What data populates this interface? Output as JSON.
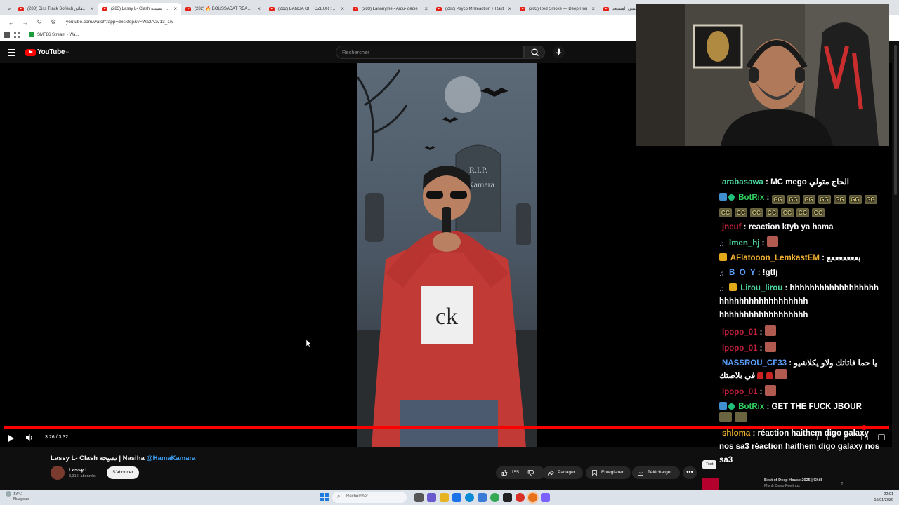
{
  "browser": {
    "tabs": [
      {
        "label": "(283) Diss Track Sofiech حقائق CL"
      },
      {
        "label": "(283) Lassy L- Clash نصيحة | Na"
      },
      {
        "label": "(282) 🔥 BOUSSADAT REACTIC"
      },
      {
        "label": "(282) BANGA OF TOZEUR : Djer"
      },
      {
        "label": "(283) Lanonyme - Ardu- dédie"
      },
      {
        "label": "(282) Psyco M Reaction + Rakt"
      },
      {
        "label": "(283) Red Smoke — Deep Hou"
      },
      {
        "label": "أين أمسي المسيعد"
      }
    ],
    "url": "youtube.com/watch?app=desktop&v=Wa2AsV13_1w",
    "bookmark": "SMF86 Stream - Wa..."
  },
  "youtube": {
    "logo": "YouTube",
    "logo_sup": "TN",
    "search_placeholder": "Rechercher"
  },
  "player": {
    "time": "3:26 / 3:32",
    "progress": 0.972
  },
  "video": {
    "title_main": "Lassy L- Clash نصيحة | Nasiha ",
    "title_tag": "@HamaKamara",
    "channel": "Lassy L",
    "subscribers": "8,31 k abonnés",
    "subscribe": "S'abonner",
    "likes": "155",
    "share": "Partager",
    "save": "Enregistrer",
    "download": "Télécharger",
    "more": "•••",
    "tombstone_line1": "R.I.P.",
    "tombstone_line2": "Kamara"
  },
  "filter_chip": "Tout",
  "recommendation": {
    "title": "Best of Deep House 2025 | Chill",
    "subtitle": "Mix & Deep Feelings"
  },
  "chat": {
    "messages": [
      {
        "user": "arabasawa",
        "user_color": "#4cd6a0",
        "text": "MC mego الحاج متولي"
      },
      {
        "user": "BotRix",
        "user_color": "#30d060",
        "text": ""
      },
      {
        "user": "jneuf",
        "user_color": "#c0203a",
        "text": "reaction ktyb ya hama"
      },
      {
        "user": "lmen_hj",
        "user_color": "#4cd6a0",
        "text": ""
      },
      {
        "user": "AFlatooon_LemkastEM",
        "user_color": "#f0b030",
        "text": "بعععععععع"
      },
      {
        "user": "B_O_Y",
        "user_color": "#5aa0ff",
        "text": "!gtfj"
      },
      {
        "user": "Lirou_lirou",
        "user_color": "#4cd6a0",
        "text": "hhhhhhhhhhhhhhhhhh hhhhhhhhhhhhhhhhhh hhhhhhhhhhhhhhhhhh"
      },
      {
        "user": "lpopo_01",
        "user_color": "#c0203a",
        "text": ""
      },
      {
        "user": "lpopo_01",
        "user_color": "#c0203a",
        "text": ""
      },
      {
        "user": "NASSROU_CF33",
        "user_color": "#5aa0ff",
        "text": "يا حما فاتاتك ولاو يكلاشيو في بلاصتك"
      },
      {
        "user": "lpopo_01",
        "user_color": "#c0203a",
        "text": ""
      },
      {
        "user": "BotRix",
        "user_color": "#30d060",
        "text": "GET THE FUCK JBOUR"
      },
      {
        "user": "shloma",
        "user_color": "#f0b030",
        "text": "réaction haithem digo galaxy nos sa3 réaction haithem digo galaxy nos sa3"
      }
    ],
    "emote_gg": "GG"
  },
  "taskbar": {
    "temp": "13°C",
    "weather": "Nuageux",
    "search": "Rechercher",
    "time": "22:01",
    "date": "16/01/2026"
  }
}
